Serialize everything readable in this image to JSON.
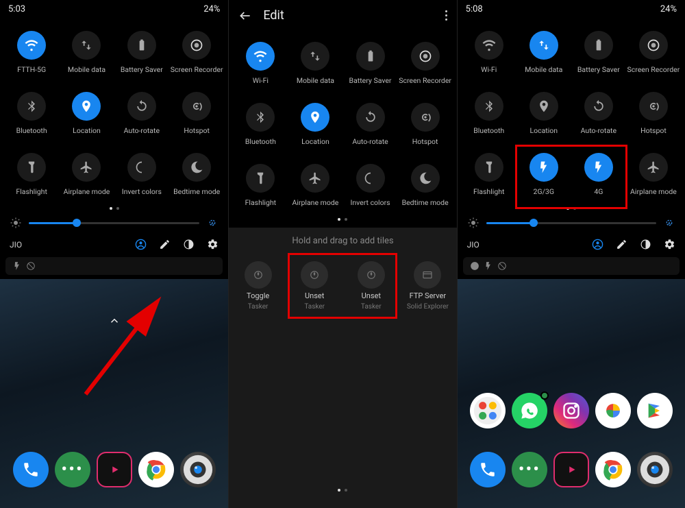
{
  "panes": [
    {
      "status": {
        "time": "5:03",
        "battery": "24%"
      },
      "tiles": [
        {
          "label": "FTTH-5G",
          "icon": "wifi",
          "active": true
        },
        {
          "label": "Mobile data",
          "icon": "data",
          "active": false
        },
        {
          "label": "Battery Saver",
          "icon": "battery",
          "active": false
        },
        {
          "label": "Screen Recorder",
          "icon": "record",
          "active": false
        },
        {
          "label": "Bluetooth",
          "icon": "bluetooth",
          "active": false
        },
        {
          "label": "Location",
          "icon": "location",
          "active": true
        },
        {
          "label": "Auto-rotate",
          "icon": "rotate",
          "active": false
        },
        {
          "label": "Hotspot",
          "icon": "hotspot",
          "active": false
        },
        {
          "label": "Flashlight",
          "icon": "flashlight",
          "active": false
        },
        {
          "label": "Airplane mode",
          "icon": "airplane",
          "active": false
        },
        {
          "label": "Invert colors",
          "icon": "invert",
          "active": false
        },
        {
          "label": "Bedtime mode",
          "icon": "bedtime",
          "active": false
        }
      ],
      "page_dots": 2,
      "active_dot": 0,
      "brightness_pct": 28,
      "footer": {
        "carrier": "JIO"
      },
      "dock_apps": [
        "phone",
        "sms",
        "youtube",
        "chrome",
        "camera"
      ]
    },
    {
      "header": {
        "title": "Edit"
      },
      "tiles": [
        {
          "label": "Wi-Fi",
          "icon": "wifi",
          "active": true
        },
        {
          "label": "Mobile data",
          "icon": "data",
          "active": false
        },
        {
          "label": "Battery Saver",
          "icon": "battery",
          "active": false
        },
        {
          "label": "Screen Recorder",
          "icon": "record",
          "active": false
        },
        {
          "label": "Bluetooth",
          "icon": "bluetooth",
          "active": false
        },
        {
          "label": "Location",
          "icon": "location",
          "active": true
        },
        {
          "label": "Auto-rotate",
          "icon": "rotate",
          "active": false
        },
        {
          "label": "Hotspot",
          "icon": "hotspot",
          "active": false
        },
        {
          "label": "Flashlight",
          "icon": "flashlight",
          "active": false
        },
        {
          "label": "Airplane mode",
          "icon": "airplane",
          "active": false
        },
        {
          "label": "Invert colors",
          "icon": "invert",
          "active": false
        },
        {
          "label": "Bedtime mode",
          "icon": "bedtime",
          "active": false
        }
      ],
      "page_dots": 2,
      "active_dot": 0,
      "hint": "Hold and drag to add tiles",
      "add_tiles": [
        {
          "label": "Toggle",
          "sub": "Tasker",
          "icon": "tasker"
        },
        {
          "label": "Unset",
          "sub": "Tasker",
          "icon": "tasker"
        },
        {
          "label": "Unset",
          "sub": "Tasker",
          "icon": "tasker"
        },
        {
          "label": "FTP Server",
          "sub": "Solid Explorer",
          "icon": "ftp"
        }
      ]
    },
    {
      "status": {
        "time": "5:08",
        "battery": "24%"
      },
      "tiles": [
        {
          "label": "Wi-Fi",
          "icon": "wifi",
          "active": false
        },
        {
          "label": "Mobile data",
          "icon": "data",
          "active": true
        },
        {
          "label": "Battery Saver",
          "icon": "battery",
          "active": false
        },
        {
          "label": "Screen Recorder",
          "icon": "record",
          "active": false
        },
        {
          "label": "Bluetooth",
          "icon": "bluetooth",
          "active": false
        },
        {
          "label": "Location",
          "icon": "location",
          "active": false
        },
        {
          "label": "Auto-rotate",
          "icon": "rotate",
          "active": false
        },
        {
          "label": "Hotspot",
          "icon": "hotspot",
          "active": false
        },
        {
          "label": "Flashlight",
          "icon": "flashlight",
          "active": false
        },
        {
          "label": "2G/3G",
          "icon": "bolt",
          "active": true
        },
        {
          "label": "4G",
          "icon": "bolt",
          "active": true
        },
        {
          "label": "Airplane mode",
          "icon": "airplane",
          "active": false
        }
      ],
      "page_dots": 2,
      "active_dot": 0,
      "brightness_pct": 28,
      "footer": {
        "carrier": "JIO"
      },
      "app_row": [
        "google",
        "whatsapp",
        "instagram",
        "photos",
        "play"
      ],
      "dock_apps": [
        "phone",
        "sms",
        "youtube",
        "chrome",
        "camera"
      ]
    }
  ]
}
